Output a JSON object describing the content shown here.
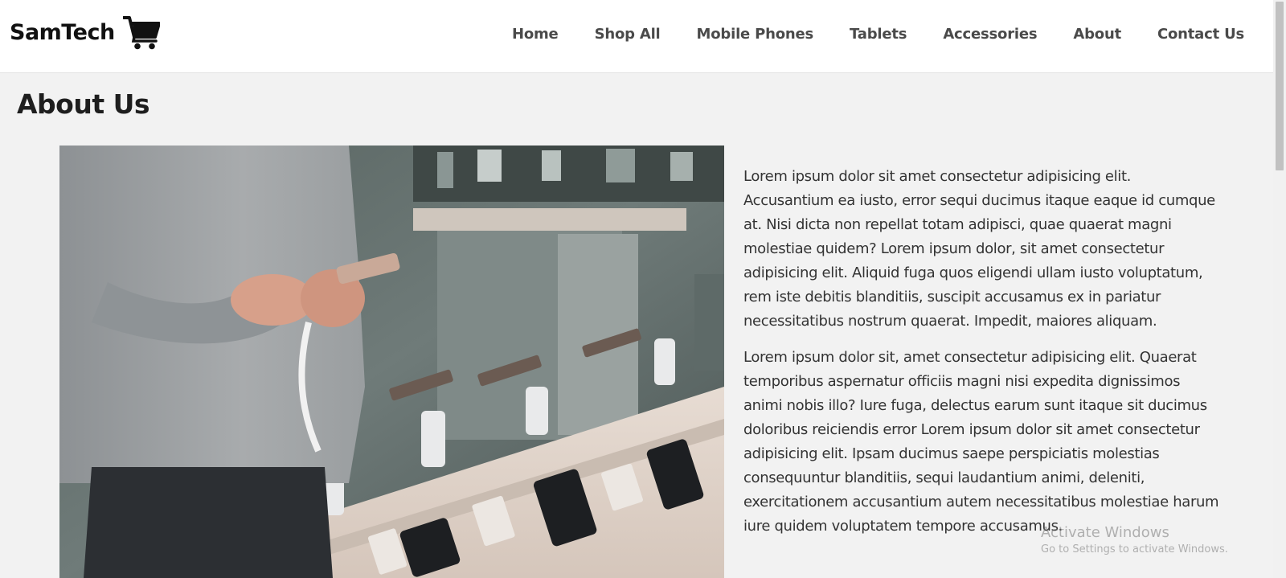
{
  "brand": {
    "name": "SamTech",
    "icon": "shopping-cart-icon"
  },
  "nav": {
    "items": [
      {
        "label": "Home"
      },
      {
        "label": "Shop All"
      },
      {
        "label": "Mobile Phones"
      },
      {
        "label": "Tablets"
      },
      {
        "label": "Accessories"
      },
      {
        "label": "About"
      },
      {
        "label": "Contact Us"
      }
    ]
  },
  "page": {
    "title": "About Us",
    "paragraphs": [
      "Lorem ipsum dolor sit amet consectetur adipisicing elit. Accusantium ea iusto, error sequi ducimus itaque eaque id cumque at. Nisi dicta non repellat totam adipisci, quae quaerat magni molestiae quidem? Lorem ipsum dolor, sit amet consectetur adipisicing elit. Aliquid fuga quos eligendi ullam iusto voluptatum, rem iste debitis blanditiis, suscipit accusamus ex in pariatur necessitatibus nostrum quaerat. Impedit, maiores aliquam.",
      "Lorem ipsum dolor sit, amet consectetur adipisicing elit. Quaerat temporibus aspernatur officiis magni nisi expedita dignissimos animi nobis illo? Iure fuga, delectus earum sunt itaque sit ducimus doloribus reiciendis error Lorem ipsum dolor sit amet consectetur adipisicing elit. Ipsam ducimus saepe perspiciatis molestias consequuntur blanditiis, sequi laudantium animi, deleniti, exercitationem accusantium autem necessitatibus molestiae harum iure quidem voluptatem tempore accusamus."
    ]
  },
  "watermark": {
    "title": "Activate Windows",
    "subtitle": "Go to Settings to activate Windows."
  },
  "colors": {
    "background": "#f2f2f2",
    "navbar": "#ffffff",
    "nav_text": "#4a4a4a",
    "heading": "#1e1e1e"
  }
}
